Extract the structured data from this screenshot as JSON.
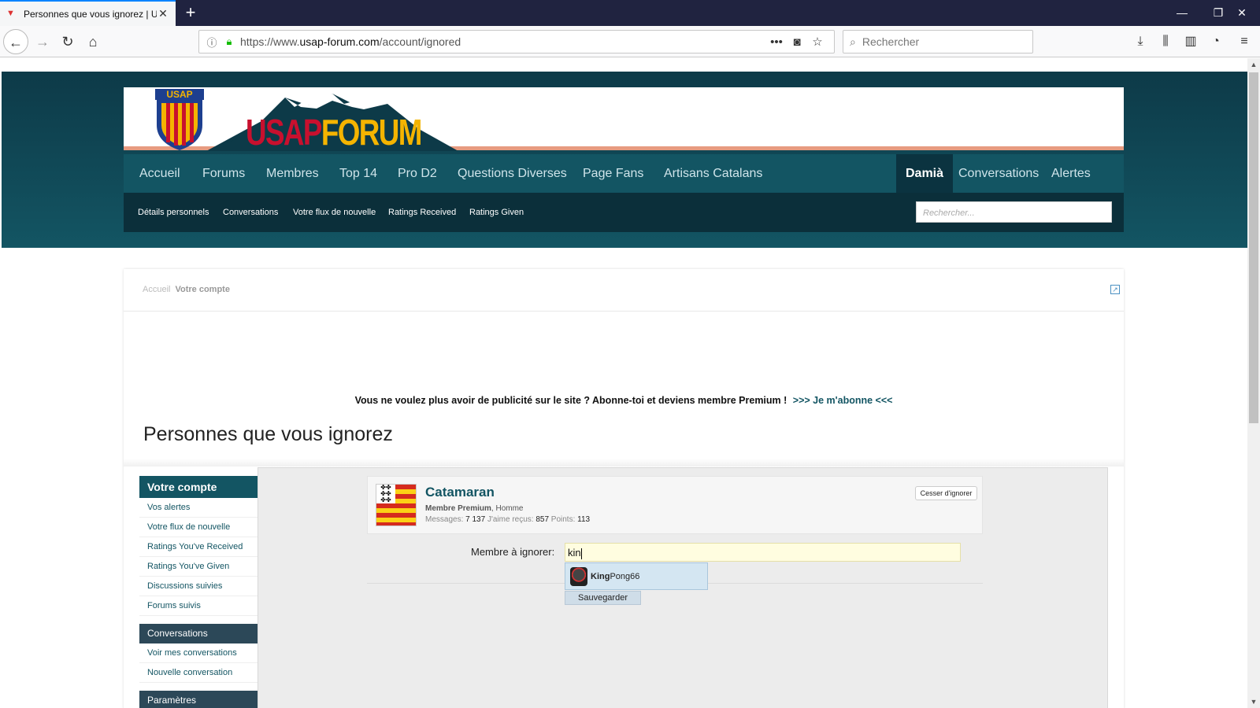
{
  "browser": {
    "tab_title": "Personnes que vous ignorez | U",
    "url_prefix": "https://www.",
    "url_domain": "usap-forum.com",
    "url_path": "/account/ignored",
    "search_placeholder": "Rechercher"
  },
  "site": {
    "logo_badge": "USAP",
    "logo_usap": "USAP",
    "logo_forum": "FORUM",
    "main_nav": [
      "Accueil",
      "Forums",
      "Membres",
      "Top 14",
      "Pro D2",
      "Questions Diverses",
      "Page Fans",
      "Artisans Catalans"
    ],
    "user_nav": {
      "username": "Damià",
      "conversations": "Conversations",
      "alerts": "Alertes"
    },
    "sub_nav": [
      "Détails personnels",
      "Conversations",
      "Votre flux de nouvelle",
      "Ratings Received",
      "Ratings Given"
    ],
    "sub_search_placeholder": "Rechercher..."
  },
  "content": {
    "breadcrumb_home": "Accueil",
    "breadcrumb_current": "Votre compte",
    "promo_text": "Vous ne voulez plus avoir de publicité sur le site ? Abonne-toi et deviens membre Premium !",
    "promo_link": ">>> Je m'abonne <<<",
    "page_title": "Personnes que vous ignorez"
  },
  "sidebar": {
    "heading": "Votre compte",
    "items": [
      "Vos alertes",
      "Votre flux de nouvelle",
      "Ratings You've Received",
      "Ratings You've Given",
      "Discussions suivies",
      "Forums suivis"
    ],
    "conv_heading": "Conversations",
    "conv_items": [
      "Voir mes conversations",
      "Nouvelle conversation"
    ],
    "params_heading": "Paramètres"
  },
  "ignored_member": {
    "name": "Catamaran",
    "rank": "Membre Premium",
    "gender": "Homme",
    "messages_label": "Messages:",
    "messages": "7 137",
    "likes_label": "J'aime reçus:",
    "likes": "857",
    "points_label": "Points:",
    "points": "113",
    "unignore_label": "Cesser d'ignorer"
  },
  "form": {
    "label": "Membre à ignorer:",
    "value": "kin",
    "suggestion_match": "King",
    "suggestion_rest": "Pong66",
    "save_label": "Sauvegarder"
  },
  "colors": {
    "brand": "#135563",
    "brand_dark": "#0b2f3a",
    "accent": "#e79b80"
  }
}
